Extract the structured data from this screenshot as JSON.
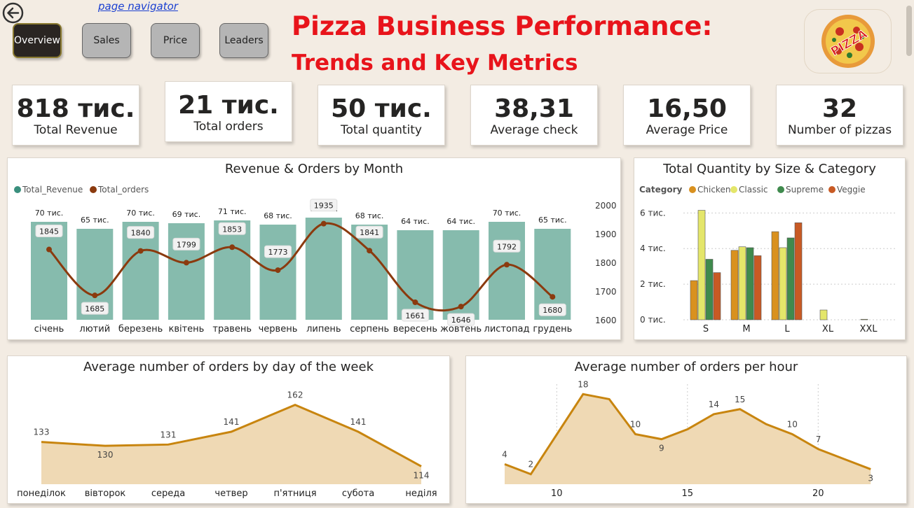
{
  "nav": {
    "link": "page navigator",
    "buttons": [
      "Overview",
      "Sales",
      "Price",
      "Leaders"
    ]
  },
  "header": {
    "title_line1": "Pizza Business Performance:",
    "title_line2": "Trends and Key Metrics",
    "logo_text": "PIZZA"
  },
  "kpis": [
    {
      "value": "818 тис.",
      "label": "Total Revenue"
    },
    {
      "value": "21 тис.",
      "label": "Total orders"
    },
    {
      "value": "50 тис.",
      "label": "Total quantity"
    },
    {
      "value": "38,31",
      "label": "Average check"
    },
    {
      "value": "16,50",
      "label": "Average Price"
    },
    {
      "value": "32",
      "label": "Number of pizzas"
    }
  ],
  "colors": {
    "accent_red": "#e8141b",
    "revenue_bar": "#86bbad",
    "orders_line": "#8b3a0e",
    "area_line": "#c8850f",
    "area_fill": "#efd9b4",
    "chicken": "#d9911f",
    "classic": "#e4e66a",
    "supreme": "#3f8a4d",
    "veggie": "#c85a24"
  },
  "chart_data": [
    {
      "type": "bar",
      "title": "Revenue & Orders by Month",
      "legend": [
        "Total_Revenue",
        "Total_orders"
      ],
      "categories": [
        "січень",
        "лютий",
        "березень",
        "квітень",
        "травень",
        "червень",
        "липень",
        "серпень",
        "вересень",
        "жовтень",
        "листопад",
        "грудень"
      ],
      "series": [
        {
          "name": "Total_Revenue",
          "values": [
            70,
            65,
            70,
            69,
            71,
            68,
            73,
            68,
            64,
            64,
            70,
            65
          ],
          "labels": [
            "70 тис.",
            "65 тис.",
            "70 тис.",
            "69 тис.",
            "71 тис.",
            "68 тис.",
            "73 тис.",
            "68 тис.",
            "64 тис.",
            "64 тис.",
            "70 тис.",
            "65 тис."
          ]
        },
        {
          "name": "Total_orders",
          "type": "line",
          "values": [
            1845,
            1685,
            1840,
            1799,
            1853,
            1773,
            1935,
            1841,
            1661,
            1646,
            1792,
            1680
          ]
        }
      ],
      "y2_ticks": [
        "2000",
        "1900",
        "1800",
        "1700",
        "1600"
      ],
      "y2lim": [
        1600,
        2000
      ]
    },
    {
      "type": "bar",
      "title": "Total Quantity by Size & Category",
      "legend_title": "Category",
      "categories": [
        "S",
        "M",
        "L",
        "XL",
        "XXL"
      ],
      "series": [
        {
          "name": "Chicken",
          "values": [
            2200,
            3900,
            4950,
            0,
            0
          ]
        },
        {
          "name": "Classic",
          "values": [
            6150,
            4100,
            4050,
            550,
            30
          ]
        },
        {
          "name": "Supreme",
          "values": [
            3400,
            4050,
            4600,
            0,
            0
          ]
        },
        {
          "name": "Veggie",
          "values": [
            2650,
            3600,
            5450,
            0,
            0
          ]
        }
      ],
      "y_ticks": [
        "6 тис.",
        "4 тис.",
        "2 тис.",
        "0 тис."
      ],
      "ylim": [
        0,
        6800
      ]
    },
    {
      "type": "area",
      "title": "Average number of orders by day of the week",
      "categories": [
        "понеділок",
        "вівторок",
        "середа",
        "четвер",
        "п'ятниця",
        "субота",
        "неділя"
      ],
      "values": [
        133,
        130,
        131,
        141,
        162,
        141,
        114
      ]
    },
    {
      "type": "area",
      "title": "Average number of orders per hour",
      "x": [
        9,
        10,
        11,
        12,
        13,
        14,
        15,
        16,
        17,
        18,
        19,
        20,
        21,
        22,
        23
      ],
      "values": [
        4,
        2,
        10,
        18,
        17,
        10,
        9,
        11,
        14,
        15,
        12,
        10,
        7,
        5,
        3
      ],
      "point_labels": [
        4,
        2,
        null,
        18,
        null,
        10,
        9,
        null,
        14,
        15,
        null,
        10,
        7,
        null,
        3
      ],
      "x_ticks": [
        10,
        15,
        20
      ]
    }
  ]
}
